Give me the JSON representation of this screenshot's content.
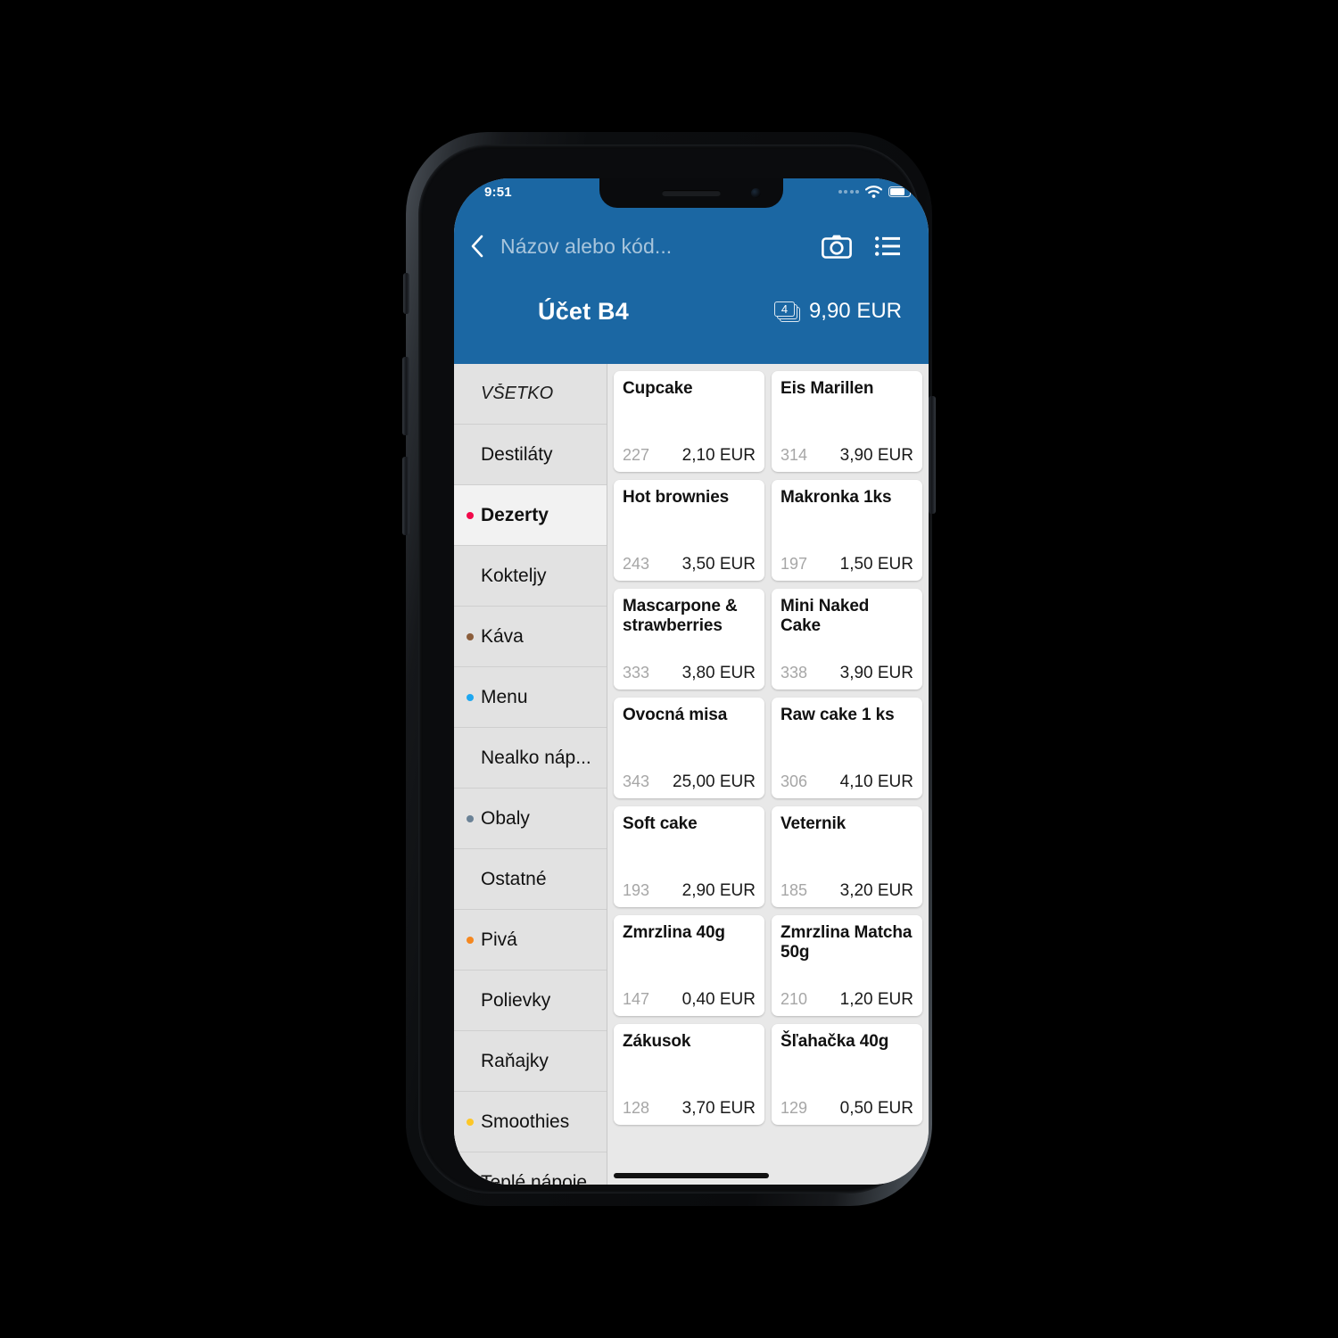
{
  "status_bar": {
    "time": "9:51",
    "signal_icon": "signal-dots-icon",
    "wifi_icon": "wifi-icon",
    "battery_icon": "battery-icon"
  },
  "header": {
    "back_icon": "chevron-left-icon",
    "search_placeholder": "Názov alebo kód...",
    "search_value": "",
    "camera_icon": "camera-icon",
    "list_icon": "list-icon",
    "account_title": "Účet B4",
    "cart_count": "4",
    "cart_total": "9,90 EUR",
    "accent_color": "#1b67a3"
  },
  "sidebar": {
    "categories": [
      {
        "label": "VŠETKO",
        "dot": null,
        "selected": false,
        "all": true
      },
      {
        "label": "Destiláty",
        "dot": null,
        "selected": false
      },
      {
        "label": "Dezerty",
        "dot": "#f2094a",
        "selected": true
      },
      {
        "label": "Kokteljy",
        "dot": null,
        "selected": false
      },
      {
        "label": "Káva",
        "dot": "#8b5e3c",
        "selected": false
      },
      {
        "label": "Menu",
        "dot": "#1ea7f0",
        "selected": false
      },
      {
        "label": "Nealko náp...",
        "dot": null,
        "selected": false
      },
      {
        "label": "Obaly",
        "dot": "#6b8296",
        "selected": false
      },
      {
        "label": "Ostatné",
        "dot": null,
        "selected": false
      },
      {
        "label": "Pivá",
        "dot": "#f5871f",
        "selected": false
      },
      {
        "label": "Polievky",
        "dot": null,
        "selected": false
      },
      {
        "label": "Raňajky",
        "dot": null,
        "selected": false
      },
      {
        "label": "Smoothies",
        "dot": "#fdc727",
        "selected": false
      },
      {
        "label": "Teplé nápoje",
        "dot": "#ef3b2d",
        "selected": false
      }
    ]
  },
  "products": [
    {
      "name": "Cupcake",
      "code": "227",
      "price": "2,10 EUR"
    },
    {
      "name": "Eis Marillen",
      "code": "314",
      "price": "3,90 EUR"
    },
    {
      "name": "Hot brownies",
      "code": "243",
      "price": "3,50 EUR"
    },
    {
      "name": "Makronka 1ks",
      "code": "197",
      "price": "1,50 EUR"
    },
    {
      "name": "Mascarpone & strawberries",
      "code": "333",
      "price": "3,80 EUR"
    },
    {
      "name": "Mini Naked Cake",
      "code": "338",
      "price": "3,90 EUR"
    },
    {
      "name": "Ovocná misa",
      "code": "343",
      "price": "25,00 EUR"
    },
    {
      "name": "Raw cake 1 ks",
      "code": "306",
      "price": "4,10 EUR"
    },
    {
      "name": "Soft cake",
      "code": "193",
      "price": "2,90 EUR"
    },
    {
      "name": "Veternik",
      "code": "185",
      "price": "3,20 EUR"
    },
    {
      "name": "Zmrzlina 40g",
      "code": "147",
      "price": "0,40 EUR"
    },
    {
      "name": "Zmrzlina Matcha 50g",
      "code": "210",
      "price": "1,20 EUR"
    },
    {
      "name": "Zákusok",
      "code": "128",
      "price": "3,70 EUR"
    },
    {
      "name": "Šľahačka 40g",
      "code": "129",
      "price": "0,50 EUR"
    }
  ]
}
